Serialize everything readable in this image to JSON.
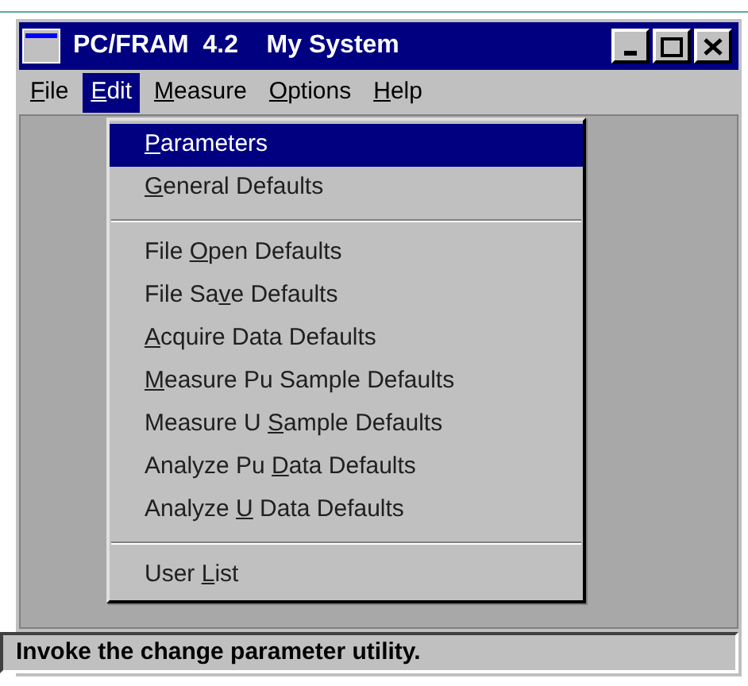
{
  "window": {
    "title": "PC/FRAM  4.2    My System"
  },
  "menu_bar": [
    {
      "key": "F",
      "after": "ile",
      "selected": false
    },
    {
      "key": "E",
      "after": "dit",
      "selected": true
    },
    {
      "key": "M",
      "after": "easure",
      "selected": false
    },
    {
      "key": "O",
      "after": "ptions",
      "selected": false
    },
    {
      "key": "H",
      "after": "elp",
      "selected": false
    }
  ],
  "dropdown": [
    {
      "kind": "item",
      "key": "P",
      "after": "arameters",
      "selected": true
    },
    {
      "kind": "item",
      "key": "G",
      "after": "eneral Defaults",
      "selected": false
    },
    {
      "kind": "separator"
    },
    {
      "kind": "item",
      "before": "File ",
      "key": "O",
      "after": "pen Defaults",
      "selected": false
    },
    {
      "kind": "item",
      "before": "File Sa",
      "key": "v",
      "after": "e Defaults",
      "selected": false
    },
    {
      "kind": "item",
      "key": "A",
      "after": "cquire Data Defaults",
      "selected": false
    },
    {
      "kind": "item",
      "key": "M",
      "after": "easure Pu Sample Defaults",
      "selected": false
    },
    {
      "kind": "item",
      "before": "Measure U ",
      "key": "S",
      "after": "ample Defaults",
      "selected": false
    },
    {
      "kind": "item",
      "before": "Analyze Pu ",
      "key": "D",
      "after": "ata Defaults",
      "selected": false
    },
    {
      "kind": "item",
      "before": "Analyze ",
      "key": "U",
      "after": " Data Defaults",
      "selected": false
    },
    {
      "kind": "separator"
    },
    {
      "kind": "item",
      "before": "User ",
      "key": "L",
      "after": "ist",
      "selected": false
    }
  ],
  "status_bar": {
    "text": "Invoke the change parameter utility."
  }
}
